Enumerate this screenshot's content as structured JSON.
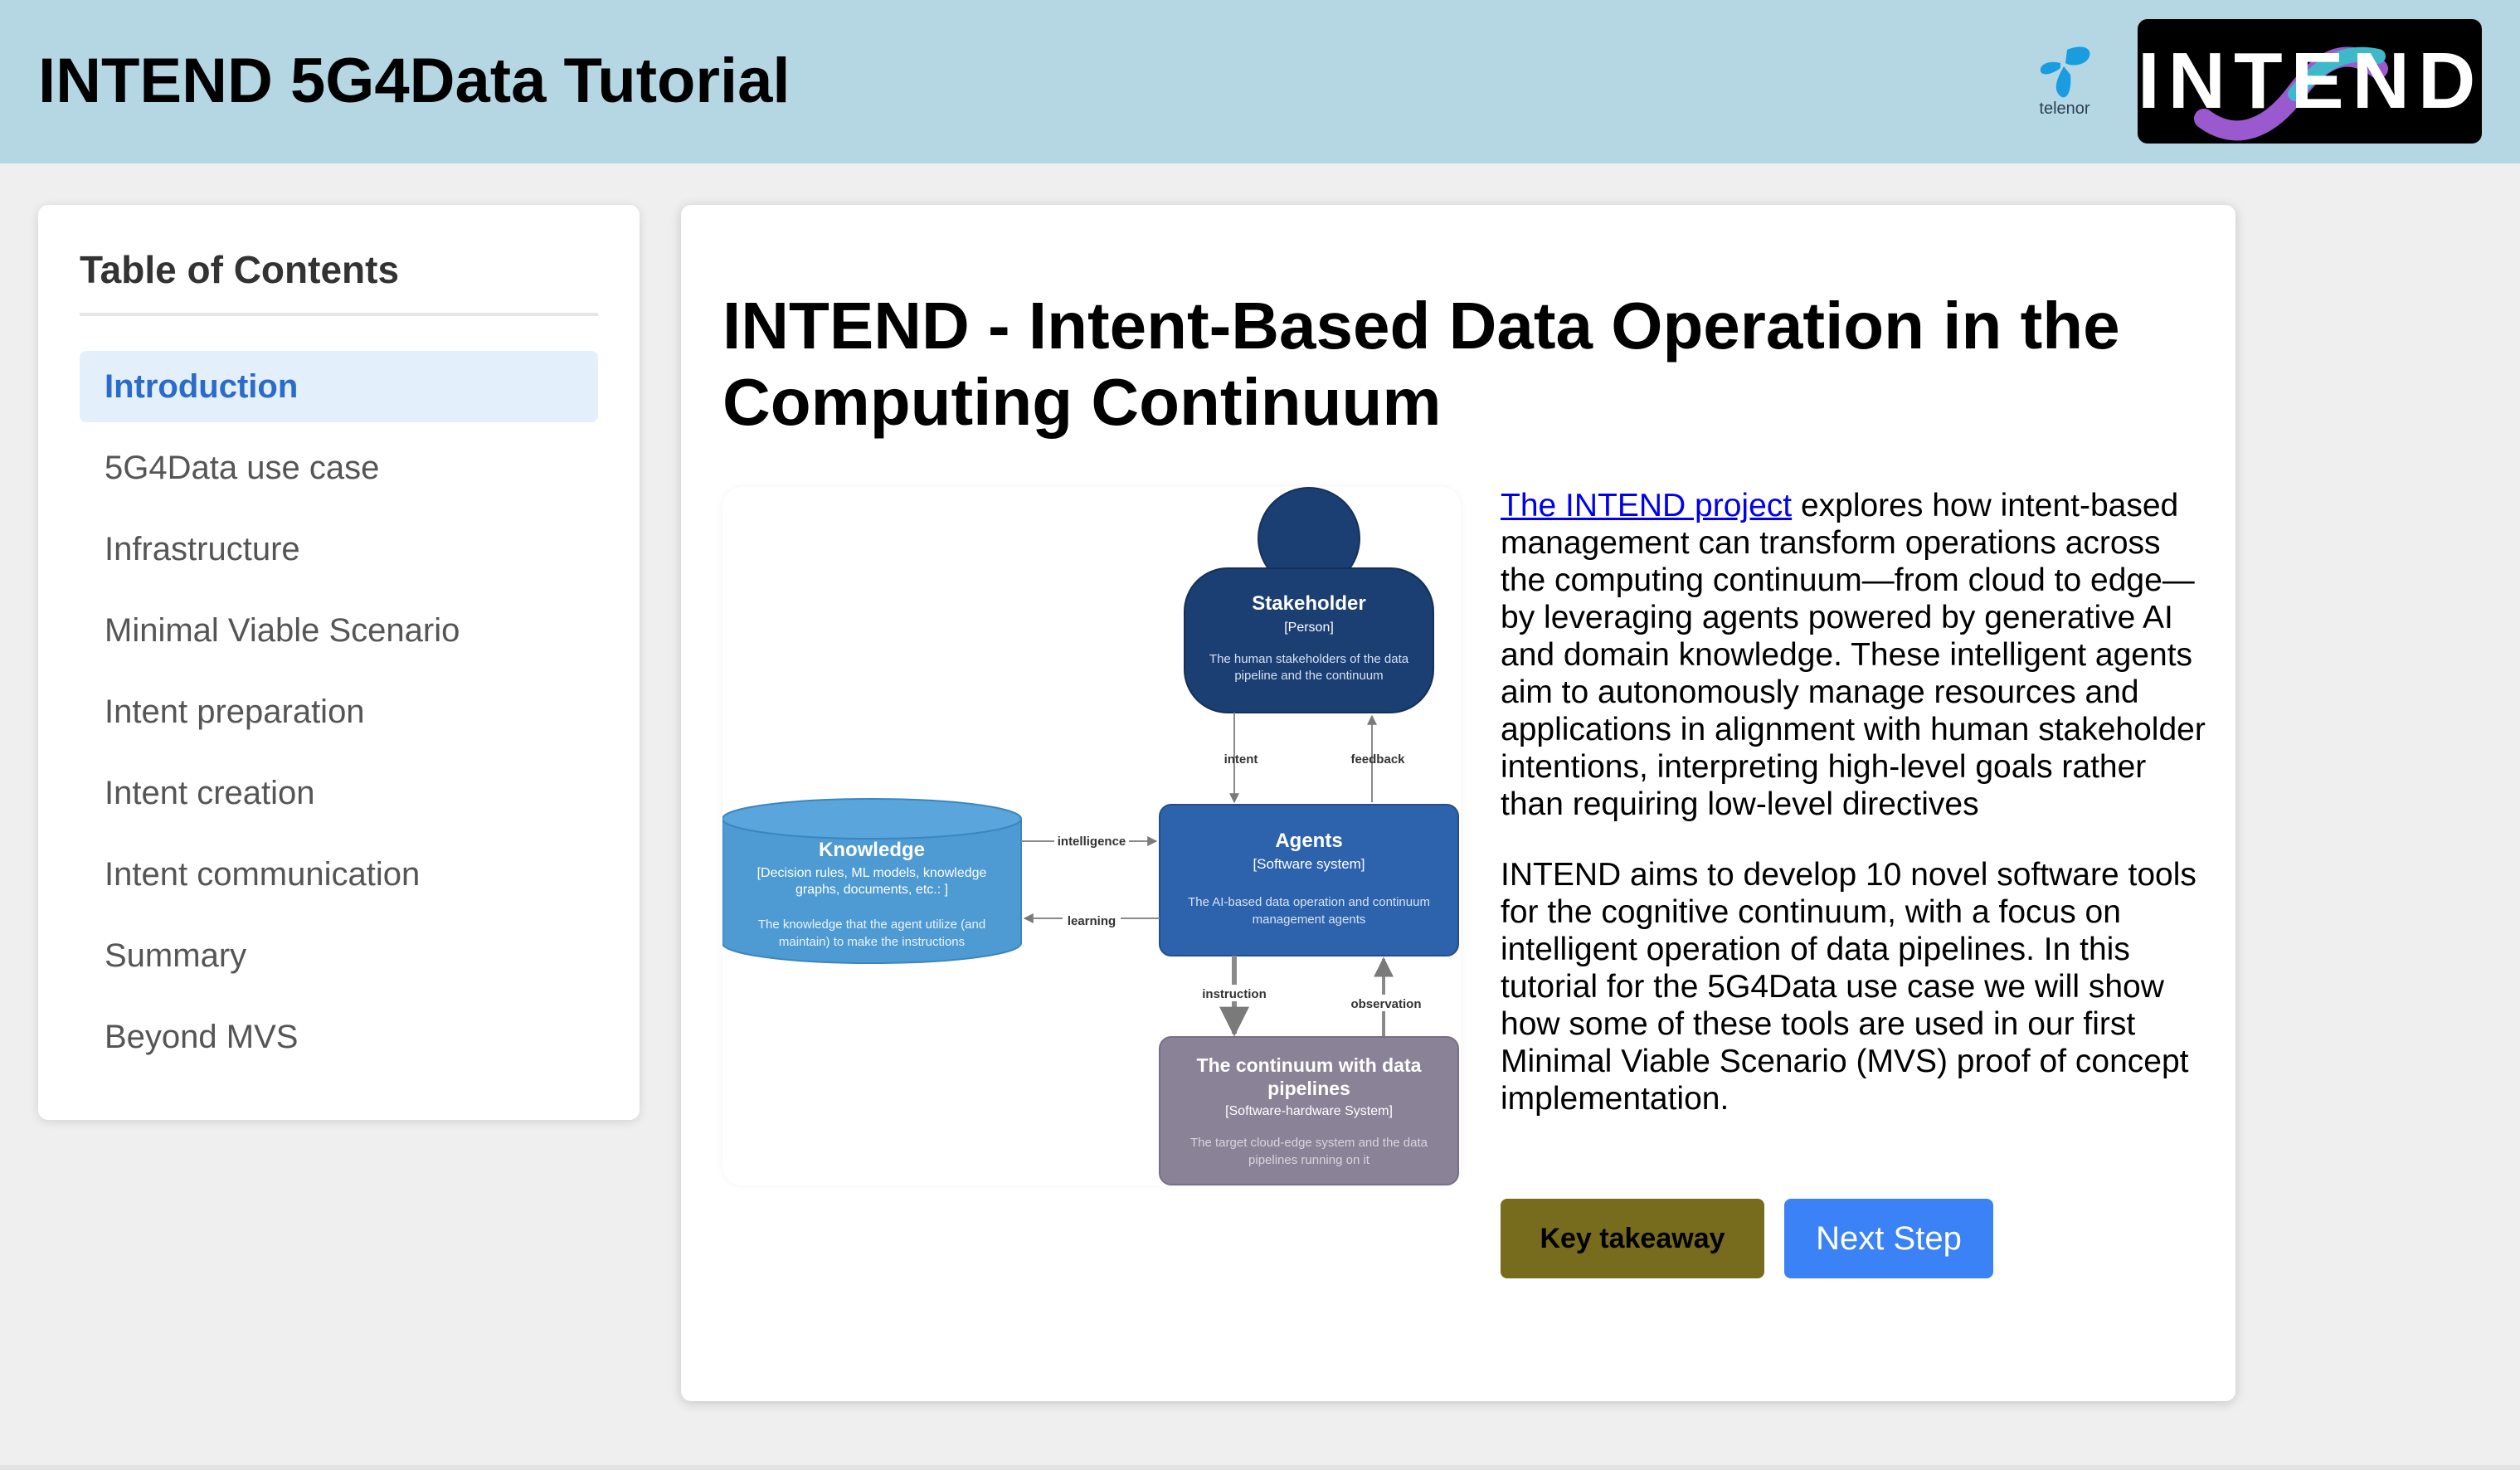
{
  "header": {
    "title": "INTEND 5G4Data Tutorial",
    "telenor_logo_text": "telenor",
    "intend_logo_text": "INTEND"
  },
  "sidebar": {
    "title": "Table of Contents",
    "items": [
      {
        "label": "Introduction",
        "active": true
      },
      {
        "label": "5G4Data use case",
        "active": false
      },
      {
        "label": "Infrastructure",
        "active": false
      },
      {
        "label": "Minimal Viable Scenario",
        "active": false
      },
      {
        "label": "Intent preparation",
        "active": false
      },
      {
        "label": "Intent creation",
        "active": false
      },
      {
        "label": "Intent communication",
        "active": false
      },
      {
        "label": "Summary",
        "active": false
      },
      {
        "label": "Beyond MVS",
        "active": false
      }
    ]
  },
  "main": {
    "title": "INTEND - Intent-Based Data Operation in the Computing Continuum",
    "paragraph1_link": "The INTEND project",
    "paragraph1_rest": " explores how intent-based management can transform operations across the computing continuum—from cloud to edge—by leveraging agents powered by generative AI and domain knowledge. These intelligent agents aim to autonomously manage resources and applications in alignment with human stakeholder intentions, interpreting high-level goals rather than requiring low-level directives",
    "paragraph2": "INTEND aims to develop 10 novel software tools for the cognitive continuum, with a focus on intelligent operation of data pipelines. In this tutorial for the 5G4Data use case we will show how some of these tools are used in our first Minimal Viable Scenario (MVS) proof of concept implementation.",
    "key_takeaway_label": "Key takeaway",
    "next_step_label": "Next Step"
  },
  "diagram": {
    "stakeholder": {
      "title": "Stakeholder",
      "type": "[Person]",
      "desc1": "The human stakeholders of the data",
      "desc2": "pipeline and the continuum"
    },
    "agents": {
      "title": "Agents",
      "type": "[Software system]",
      "desc1": "The AI-based data operation and continuum",
      "desc2": "management agents"
    },
    "knowledge": {
      "title": "Knowledge",
      "type1": "[Decision rules, ML models, knowledge",
      "type2": "graphs, documents, etc.: ]",
      "desc1": "The knowledge that the agent utilize (and",
      "desc2": "maintain) to make the instructions"
    },
    "continuum": {
      "title1": "The continuum with data",
      "title2": "pipelines",
      "type": "[Software-hardware System]",
      "desc1": "The target cloud-edge system and the data",
      "desc2": "pipelines running on it"
    },
    "edges": {
      "intent": "intent",
      "feedback": "feedback",
      "intelligence": "intelligence",
      "learning": "learning",
      "instruction": "instruction",
      "observation": "observation"
    },
    "colors": {
      "stakeholder": "#1b3e73",
      "agents": "#2d62ad",
      "knowledge": "#4e9ad3",
      "continuum": "#8a8297"
    }
  }
}
